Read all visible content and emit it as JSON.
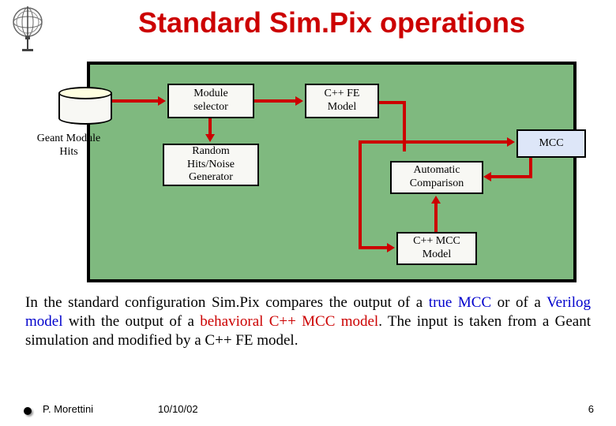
{
  "title": "Standard Sim.Pix operations",
  "diagram": {
    "geant_label": "Geant Module\nHits",
    "module_selector": "Module\nselector",
    "random_gen": "Random\nHits/Noise\nGenerator",
    "cpp_fe": "C++ FE\nModel",
    "mcc": "MCC",
    "auto_compare": "Automatic\nComparison",
    "cpp_mcc": "C++ MCC\nModel"
  },
  "body": {
    "line1a": "In the standard configuration Sim.Pix compares the output of a ",
    "true_mcc": "true MCC",
    "line1b": " or of a ",
    "verilog": "Verilog model",
    "line1c": " with the output of a ",
    "cpp_mcc_model": "behavioral C++ MCC model",
    "line1d": ". The input is taken from a Geant simulation and  modified by a C++ FE model."
  },
  "footer": {
    "author": "P. Morettini",
    "date": "10/10/02",
    "page": "6"
  }
}
